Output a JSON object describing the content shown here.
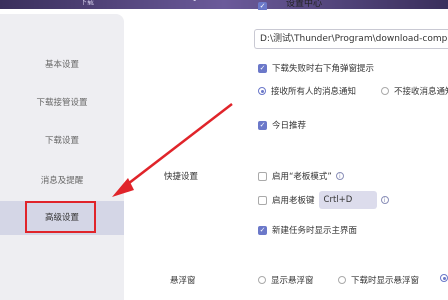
{
  "header": {
    "left_text": "下载",
    "dot": "•",
    "panel_title": "设置中心"
  },
  "sidebar": {
    "items": [
      {
        "label": "基本设置",
        "active": false
      },
      {
        "label": "下载接管设置",
        "active": false
      },
      {
        "label": "下载设置",
        "active": false
      },
      {
        "label": "消息及提醒",
        "active": false
      },
      {
        "label": "高级设置",
        "active": true
      }
    ]
  },
  "download": {
    "path_value": "D:\\测试\\Thunder\\Program\\download-complet",
    "fail_popup_label": "下载失败时右下角弹窗提示",
    "receive_all_label": "接收所有人的消息通知",
    "receive_none_label": "不接收消息通知",
    "today_recommend_label": "今日推荐"
  },
  "shortcut": {
    "section_label": "快捷设置",
    "boss_mode_label": "启用“老板模式”",
    "boss_key_label": "启用老板键",
    "boss_key_value": "Crtl+D",
    "show_main_label": "新建任务时显示主界面",
    "info_glyph": "i"
  },
  "float_window": {
    "section_label": "悬浮窗",
    "show_label": "显示悬浮窗",
    "when_download_label": "下载时显示悬浮窗"
  },
  "annotation_color": "#e0242a",
  "accent_color": "#6b78c9"
}
